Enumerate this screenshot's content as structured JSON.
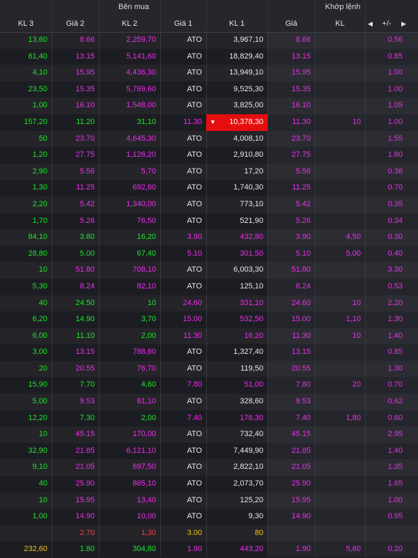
{
  "colors": {
    "green": "#1ee82a",
    "pink": "#f02cf0",
    "red": "#ff3b3b",
    "yellow": "#f2c21b",
    "highlight": "#e50e0e"
  },
  "groups": {
    "buy": "Bên mua",
    "matched": "Khớp lệnh"
  },
  "headers": [
    "KL 3",
    "Giá 2",
    "KL 2",
    "Giá 1",
    "KL 1",
    "Giá",
    "KL",
    "+/-"
  ],
  "nav": {
    "prev_icon": "caret-left-icon",
    "next_icon": "caret-right-icon"
  },
  "rows": [
    {
      "c": [
        "13,60",
        "8.66",
        "2,259,70",
        "ATO",
        "3,967,10",
        "8.66",
        "",
        "0.56"
      ],
      "k": [
        "green",
        "pink",
        "pink",
        "white",
        "white",
        "pink",
        "pink",
        "pink"
      ]
    },
    {
      "c": [
        "61,40",
        "13.15",
        "5,141,60",
        "ATO",
        "18,829,40",
        "13.15",
        "",
        "0.85"
      ],
      "k": [
        "green",
        "pink",
        "pink",
        "white",
        "white",
        "pink",
        "pink",
        "pink"
      ]
    },
    {
      "c": [
        "4,10",
        "15.95",
        "4,436,30",
        "ATO",
        "13,949,10",
        "15.95",
        "",
        "1.00"
      ],
      "k": [
        "green",
        "pink",
        "pink",
        "white",
        "white",
        "pink",
        "pink",
        "pink"
      ]
    },
    {
      "c": [
        "23,50",
        "15.35",
        "5,769,60",
        "ATO",
        "9,525,30",
        "15.35",
        "",
        "1.00"
      ],
      "k": [
        "green",
        "pink",
        "pink",
        "white",
        "white",
        "pink",
        "pink",
        "pink"
      ]
    },
    {
      "c": [
        "1,00",
        "16.10",
        "1,548,00",
        "ATO",
        "3,825,00",
        "16.10",
        "",
        "1.05"
      ],
      "k": [
        "green",
        "pink",
        "pink",
        "white",
        "white",
        "pink",
        "pink",
        "pink"
      ]
    },
    {
      "c": [
        "157,20",
        "11.20",
        "31,10",
        "11.30",
        "10,378,30",
        "11.30",
        "10",
        "1.00"
      ],
      "k": [
        "green",
        "green",
        "green",
        "pink",
        "hi",
        "pink",
        "pink",
        "pink"
      ],
      "arrow": true
    },
    {
      "c": [
        "50",
        "23.70",
        "4,645,30",
        "ATO",
        "4,008,10",
        "23.70",
        "",
        "1.55"
      ],
      "k": [
        "green",
        "pink",
        "pink",
        "white",
        "white",
        "pink",
        "pink",
        "pink"
      ]
    },
    {
      "c": [
        "1,20",
        "27.75",
        "1,126,20",
        "ATO",
        "2,910,80",
        "27.75",
        "",
        "1.80"
      ],
      "k": [
        "green",
        "pink",
        "pink",
        "white",
        "white",
        "pink",
        "pink",
        "pink"
      ]
    },
    {
      "c": [
        "2,90",
        "5.56",
        "5,70",
        "ATO",
        "17,20",
        "5.56",
        "",
        "0.36"
      ],
      "k": [
        "green",
        "pink",
        "pink",
        "white",
        "white",
        "pink",
        "pink",
        "pink"
      ]
    },
    {
      "c": [
        "1,30",
        "11.25",
        "692,60",
        "ATO",
        "1,740,30",
        "11.25",
        "",
        "0.70"
      ],
      "k": [
        "green",
        "pink",
        "pink",
        "white",
        "white",
        "pink",
        "pink",
        "pink"
      ]
    },
    {
      "c": [
        "2,20",
        "5.42",
        "1,340,00",
        "ATO",
        "773,10",
        "5.42",
        "",
        "0.35"
      ],
      "k": [
        "green",
        "pink",
        "pink",
        "white",
        "white",
        "pink",
        "pink",
        "pink"
      ]
    },
    {
      "c": [
        "1,70",
        "5.26",
        "76,50",
        "ATO",
        "521,90",
        "5.26",
        "",
        "0.34"
      ],
      "k": [
        "green",
        "pink",
        "pink",
        "white",
        "white",
        "pink",
        "pink",
        "pink"
      ]
    },
    {
      "c": [
        "84,10",
        "3.80",
        "16,20",
        "3.90",
        "432,80",
        "3.90",
        "4,50",
        "0.30"
      ],
      "k": [
        "green",
        "green",
        "green",
        "pink",
        "pink",
        "pink",
        "pink",
        "pink"
      ]
    },
    {
      "c": [
        "28,80",
        "5.00",
        "67,40",
        "5.10",
        "301,50",
        "5.10",
        "5,00",
        "0.40"
      ],
      "k": [
        "green",
        "green",
        "green",
        "pink",
        "pink",
        "pink",
        "pink",
        "pink"
      ]
    },
    {
      "c": [
        "10",
        "51.80",
        "708,10",
        "ATO",
        "6,003,30",
        "51.80",
        "",
        "3.30"
      ],
      "k": [
        "green",
        "pink",
        "pink",
        "white",
        "white",
        "pink",
        "pink",
        "pink"
      ]
    },
    {
      "c": [
        "5,30",
        "8.24",
        "82,10",
        "ATO",
        "125,10",
        "8.24",
        "",
        "0.53"
      ],
      "k": [
        "green",
        "pink",
        "pink",
        "white",
        "white",
        "pink",
        "pink",
        "pink"
      ]
    },
    {
      "c": [
        "40",
        "24.50",
        "10",
        "24.60",
        "331,10",
        "24.60",
        "10",
        "2.20"
      ],
      "k": [
        "green",
        "green",
        "green",
        "pink",
        "pink",
        "pink",
        "pink",
        "pink"
      ]
    },
    {
      "c": [
        "6,20",
        "14.90",
        "3,70",
        "15.00",
        "532,50",
        "15.00",
        "1,10",
        "1.30"
      ],
      "k": [
        "green",
        "green",
        "green",
        "pink",
        "pink",
        "pink",
        "pink",
        "pink"
      ]
    },
    {
      "c": [
        "6,00",
        "11.10",
        "2,00",
        "11.30",
        "16,20",
        "11.30",
        "10",
        "1.40"
      ],
      "k": [
        "green",
        "green",
        "green",
        "pink",
        "pink",
        "pink",
        "pink",
        "pink"
      ]
    },
    {
      "c": [
        "3,00",
        "13.15",
        "788,80",
        "ATO",
        "1,327,40",
        "13.15",
        "",
        "0.85"
      ],
      "k": [
        "green",
        "pink",
        "pink",
        "white",
        "white",
        "pink",
        "pink",
        "pink"
      ]
    },
    {
      "c": [
        "20",
        "20.55",
        "76,70",
        "ATO",
        "119,50",
        "20.55",
        "",
        "1.30"
      ],
      "k": [
        "green",
        "pink",
        "pink",
        "white",
        "white",
        "pink",
        "pink",
        "pink"
      ]
    },
    {
      "c": [
        "15,90",
        "7.70",
        "4,60",
        "7.80",
        "51,00",
        "7.80",
        "20",
        "0.70"
      ],
      "k": [
        "green",
        "green",
        "green",
        "pink",
        "pink",
        "pink",
        "pink",
        "pink"
      ]
    },
    {
      "c": [
        "5,00",
        "9.53",
        "81,10",
        "ATO",
        "328,60",
        "9.53",
        "",
        "0.62"
      ],
      "k": [
        "green",
        "pink",
        "pink",
        "white",
        "white",
        "pink",
        "pink",
        "pink"
      ]
    },
    {
      "c": [
        "12,20",
        "7.30",
        "2,00",
        "7.40",
        "176,30",
        "7.40",
        "1,80",
        "0.60"
      ],
      "k": [
        "green",
        "green",
        "green",
        "pink",
        "pink",
        "pink",
        "pink",
        "pink"
      ]
    },
    {
      "c": [
        "10",
        "45.15",
        "170,00",
        "ATO",
        "732,40",
        "45.15",
        "",
        "2.95"
      ],
      "k": [
        "green",
        "pink",
        "pink",
        "white",
        "white",
        "pink",
        "pink",
        "pink"
      ]
    },
    {
      "c": [
        "32,90",
        "21.85",
        "6,121,10",
        "ATO",
        "7,449,90",
        "21.85",
        "",
        "1.40"
      ],
      "k": [
        "green",
        "pink",
        "pink",
        "white",
        "white",
        "pink",
        "pink",
        "pink"
      ]
    },
    {
      "c": [
        "9,10",
        "21.05",
        "697,50",
        "ATO",
        "2,822,10",
        "21.05",
        "",
        "1.35"
      ],
      "k": [
        "green",
        "pink",
        "pink",
        "white",
        "white",
        "pink",
        "pink",
        "pink"
      ]
    },
    {
      "c": [
        "40",
        "25.90",
        "865,10",
        "ATO",
        "2,073,70",
        "25.90",
        "",
        "1.65"
      ],
      "k": [
        "green",
        "pink",
        "pink",
        "white",
        "white",
        "pink",
        "pink",
        "pink"
      ]
    },
    {
      "c": [
        "10",
        "15.95",
        "13,40",
        "ATO",
        "125,20",
        "15.95",
        "",
        "1.00"
      ],
      "k": [
        "green",
        "pink",
        "pink",
        "white",
        "white",
        "pink",
        "pink",
        "pink"
      ]
    },
    {
      "c": [
        "1,00",
        "14.90",
        "10,00",
        "ATO",
        "9,30",
        "14.90",
        "",
        "0.95"
      ],
      "k": [
        "green",
        "pink",
        "pink",
        "white",
        "white",
        "pink",
        "pink",
        "pink"
      ]
    },
    {
      "c": [
        "",
        "2.70",
        "1,30",
        "3.00",
        "80",
        "",
        "",
        ""
      ],
      "k": [
        "green",
        "red",
        "red",
        "yellow",
        "yellow",
        "pink",
        "pink",
        "pink"
      ]
    },
    {
      "c": [
        "232,60",
        "1.80",
        "304,80",
        "1.90",
        "443,20",
        "1.90",
        "5,60",
        "0.20"
      ],
      "k": [
        "yellow",
        "green",
        "green",
        "pink",
        "pink",
        "pink",
        "pink",
        "pink"
      ]
    }
  ]
}
